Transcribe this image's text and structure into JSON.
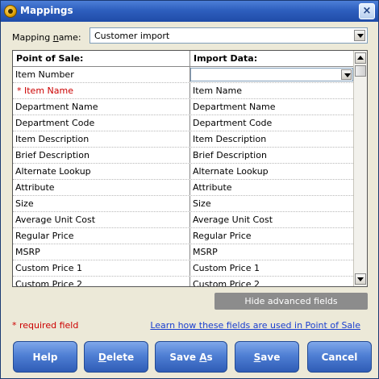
{
  "window": {
    "title": "Mappings"
  },
  "mapping": {
    "label_prefix": "Mapping ",
    "label_accel": "n",
    "label_suffix": "ame:",
    "selected": "Customer import"
  },
  "grid": {
    "header_left": "Point of Sale:",
    "header_right": "Import Data:",
    "rows": [
      {
        "left": "Item Number",
        "right": "",
        "right_is_select": true
      },
      {
        "left": "* Item Name",
        "right": "Item Name",
        "required": true
      },
      {
        "left": "Department Name",
        "right": "Department Name"
      },
      {
        "left": "Department Code",
        "right": "Department Code"
      },
      {
        "left": "Item Description",
        "right": "Item Description"
      },
      {
        "left": "Brief Description",
        "right": "Brief Description"
      },
      {
        "left": "Alternate Lookup",
        "right": "Alternate Lookup"
      },
      {
        "left": "Attribute",
        "right": "Attribute"
      },
      {
        "left": "Size",
        "right": "Size"
      },
      {
        "left": "Average Unit Cost",
        "right": "Average Unit Cost"
      },
      {
        "left": "Regular Price",
        "right": "Regular Price"
      },
      {
        "left": "MSRP",
        "right": "MSRP"
      },
      {
        "left": "Custom Price 1",
        "right": "Custom Price 1"
      },
      {
        "left": "Custom Price 2",
        "right": "Custom Price 2"
      }
    ]
  },
  "advanced_button": "Hide advanced fields",
  "required_note": "* required field",
  "learn_link": "Learn how these fields are used in Point of Sale",
  "buttons": {
    "help": "Help",
    "delete_accel": "D",
    "delete_rest": "elete",
    "saveas_pre": "Save ",
    "saveas_accel": "A",
    "saveas_post": "s",
    "save_accel": "S",
    "save_rest": "ave",
    "cancel": "Cancel"
  },
  "colors": {
    "title_bar": "#2e5fbe",
    "button": "#4f7fd4",
    "required": "#cc0000",
    "link": "#1a3ecf"
  }
}
